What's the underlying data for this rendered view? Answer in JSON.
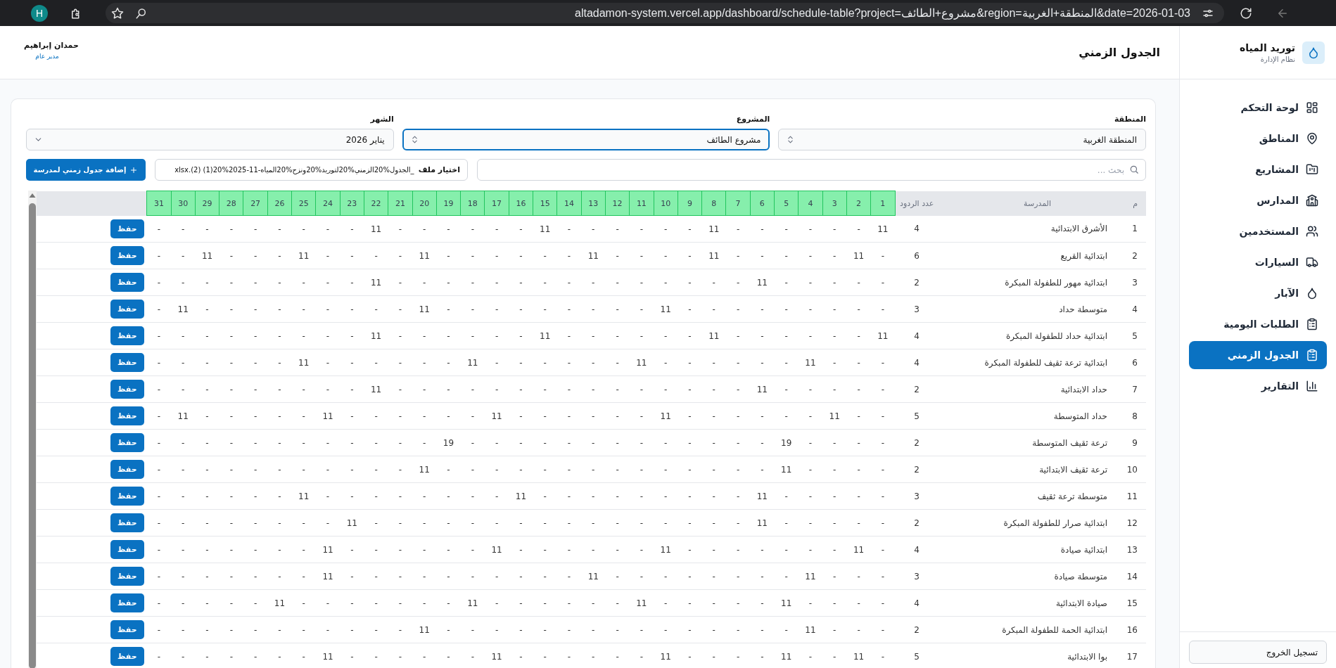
{
  "browser": {
    "profile_initial": "H",
    "url": "altadamon-system.vercel.app/dashboard/schedule-table?project=مشروع+الطائف&region=المنطقة+الغربية&date=2026-01-03"
  },
  "sidebar": {
    "brand": "توريد المياه",
    "subtitle": "نظام الإدارة",
    "items": [
      {
        "label": "لوحة التحكم",
        "selected": false
      },
      {
        "label": "المناطق",
        "selected": false
      },
      {
        "label": "المشاريع",
        "selected": false
      },
      {
        "label": "المدارس",
        "selected": false
      },
      {
        "label": "المستخدمين",
        "selected": false
      },
      {
        "label": "السيارات",
        "selected": false
      },
      {
        "label": "الآبار",
        "selected": false
      },
      {
        "label": "الطلبات اليومية",
        "selected": false
      },
      {
        "label": "الجدول الزمني",
        "selected": true
      },
      {
        "label": "التقارير",
        "selected": false
      }
    ],
    "logout": "تسجيل الخروج"
  },
  "header": {
    "title": "الجدول الزمني",
    "user_name": "حمدان إبراهيم",
    "user_role": "مدير عام"
  },
  "filters": [
    {
      "label": "المنطقة",
      "value": "المنطقة الغربية",
      "kind": "combobox",
      "focused": false
    },
    {
      "label": "المشروع",
      "value": "مشروع الطائف",
      "kind": "combobox",
      "focused": true
    },
    {
      "label": "الشهر",
      "value": "يناير 2026",
      "kind": "select",
      "focused": false
    }
  ],
  "toolbar": {
    "search": {
      "placeholder": "بحث ..."
    },
    "file": {
      "button": "اختيار ملف",
      "name": "_الجدول%20الزمني%20لتوريد%20ونزح%20المياه-11-2025%20(1) (2).xlsx"
    },
    "add_button": "إضافة جدول زمني لمدرسة"
  },
  "table": {
    "columns": {
      "index": "م",
      "school": "المدرسة",
      "count": "عدد الردود",
      "days": [
        "1",
        "2",
        "3",
        "4",
        "5",
        "6",
        "7",
        "8",
        "9",
        "10",
        "11",
        "12",
        "13",
        "14",
        "15",
        "16",
        "17",
        "18",
        "19",
        "20",
        "21",
        "22",
        "23",
        "24",
        "25",
        "26",
        "27",
        "28",
        "29",
        "30",
        "31"
      ]
    },
    "rows": [
      {
        "index": "1",
        "school": "الأشرق الابتدائية",
        "count": "4",
        "save": "حفظ",
        "cells": [
          "11",
          "-",
          "-",
          "-",
          "-",
          "-",
          "-",
          "11",
          "-",
          "-",
          "-",
          "-",
          "-",
          "-",
          "11",
          "-",
          "-",
          "-",
          "-",
          "-",
          "-",
          "11",
          "-",
          "-",
          "-",
          "-",
          "-",
          "-",
          "-",
          "-",
          "-"
        ]
      },
      {
        "index": "2",
        "school": "ابتدائية القريع",
        "count": "6",
        "save": "حفظ",
        "cells": [
          "-",
          "11",
          "-",
          "-",
          "-",
          "-",
          "-",
          "11",
          "-",
          "-",
          "-",
          "-",
          "11",
          "-",
          "-",
          "-",
          "-",
          "-",
          "-",
          "11",
          "-",
          "-",
          "-",
          "-",
          "11",
          "-",
          "-",
          "-",
          "11",
          "-",
          "-"
        ]
      },
      {
        "index": "3",
        "school": "ابتدائية مهور للطفولة المبكرة",
        "count": "2",
        "save": "حفظ",
        "cells": [
          "-",
          "-",
          "-",
          "-",
          "-",
          "11",
          "-",
          "-",
          "-",
          "-",
          "-",
          "-",
          "-",
          "-",
          "-",
          "-",
          "-",
          "-",
          "-",
          "-",
          "-",
          "11",
          "-",
          "-",
          "-",
          "-",
          "-",
          "-",
          "-",
          "-",
          "-"
        ]
      },
      {
        "index": "4",
        "school": "متوسطة حداد",
        "count": "3",
        "save": "حفظ",
        "cells": [
          "-",
          "-",
          "-",
          "-",
          "-",
          "-",
          "-",
          "-",
          "-",
          "11",
          "-",
          "-",
          "-",
          "-",
          "-",
          "-",
          "-",
          "-",
          "-",
          "11",
          "-",
          "-",
          "-",
          "-",
          "-",
          "-",
          "-",
          "-",
          "-",
          "11",
          "-"
        ]
      },
      {
        "index": "5",
        "school": "ابتدائية حداد للطفولة المبكرة",
        "count": "4",
        "save": "حفظ",
        "cells": [
          "11",
          "-",
          "-",
          "-",
          "-",
          "-",
          "-",
          "11",
          "-",
          "-",
          "-",
          "-",
          "-",
          "-",
          "11",
          "-",
          "-",
          "-",
          "-",
          "-",
          "-",
          "11",
          "-",
          "-",
          "-",
          "-",
          "-",
          "-",
          "-",
          "-",
          "-"
        ]
      },
      {
        "index": "6",
        "school": "ابتدائية ترعة ثقيف للطفولة المبكرة",
        "count": "4",
        "save": "حفظ",
        "cells": [
          "-",
          "-",
          "-",
          "11",
          "-",
          "-",
          "-",
          "-",
          "-",
          "-",
          "11",
          "-",
          "-",
          "-",
          "-",
          "-",
          "-",
          "11",
          "-",
          "-",
          "-",
          "-",
          "-",
          "-",
          "11",
          "-",
          "-",
          "-",
          "-",
          "-",
          "-"
        ]
      },
      {
        "index": "7",
        "school": "حداد الابتدائية",
        "count": "2",
        "save": "حفظ",
        "cells": [
          "-",
          "-",
          "-",
          "-",
          "-",
          "11",
          "-",
          "-",
          "-",
          "-",
          "-",
          "-",
          "-",
          "-",
          "-",
          "-",
          "-",
          "-",
          "-",
          "-",
          "-",
          "11",
          "-",
          "-",
          "-",
          "-",
          "-",
          "-",
          "-",
          "-",
          "-"
        ]
      },
      {
        "index": "8",
        "school": "حداد المتوسطة",
        "count": "5",
        "save": "حفظ",
        "cells": [
          "-",
          "-",
          "11",
          "-",
          "-",
          "-",
          "-",
          "-",
          "-",
          "11",
          "-",
          "-",
          "-",
          "-",
          "-",
          "-",
          "11",
          "-",
          "-",
          "-",
          "-",
          "-",
          "-",
          "11",
          "-",
          "-",
          "-",
          "-",
          "-",
          "11",
          "-"
        ]
      },
      {
        "index": "9",
        "school": "ترعة ثقيف المتوسطة",
        "count": "2",
        "save": "حفظ",
        "cells": [
          "-",
          "-",
          "-",
          "-",
          "19",
          "-",
          "-",
          "-",
          "-",
          "-",
          "-",
          "-",
          "-",
          "-",
          "-",
          "-",
          "-",
          "-",
          "19",
          "-",
          "-",
          "-",
          "-",
          "-",
          "-",
          "-",
          "-",
          "-",
          "-",
          "-",
          "-"
        ]
      },
      {
        "index": "10",
        "school": "ترعة ثقيف الابتدائية",
        "count": "2",
        "save": "حفظ",
        "cells": [
          "-",
          "-",
          "-",
          "-",
          "11",
          "-",
          "-",
          "-",
          "-",
          "-",
          "-",
          "-",
          "-",
          "-",
          "-",
          "-",
          "-",
          "-",
          "-",
          "11",
          "-",
          "-",
          "-",
          "-",
          "-",
          "-",
          "-",
          "-",
          "-",
          "-",
          "-"
        ]
      },
      {
        "index": "11",
        "school": "متوسطة ترعة ثقيف",
        "count": "3",
        "save": "حفظ",
        "cells": [
          "-",
          "-",
          "-",
          "-",
          "-",
          "11",
          "-",
          "-",
          "-",
          "-",
          "-",
          "-",
          "-",
          "-",
          "-",
          "11",
          "-",
          "-",
          "-",
          "-",
          "-",
          "-",
          "-",
          "-",
          "11",
          "-",
          "-",
          "-",
          "-",
          "-",
          "-"
        ]
      },
      {
        "index": "12",
        "school": "ابتدائية صرار للطفولة المبكرة",
        "count": "2",
        "save": "حفظ",
        "cells": [
          "-",
          "-",
          "-",
          "-",
          "-",
          "11",
          "-",
          "-",
          "-",
          "-",
          "-",
          "-",
          "-",
          "-",
          "-",
          "-",
          "-",
          "-",
          "-",
          "-",
          "-",
          "-",
          "11",
          "-",
          "-",
          "-",
          "-",
          "-",
          "-",
          "-",
          "-"
        ]
      },
      {
        "index": "13",
        "school": "ابتدائية صيادة",
        "count": "4",
        "save": "حفظ",
        "cells": [
          "-",
          "11",
          "-",
          "-",
          "-",
          "-",
          "-",
          "-",
          "-",
          "11",
          "-",
          "-",
          "-",
          "-",
          "-",
          "-",
          "11",
          "-",
          "-",
          "-",
          "-",
          "-",
          "-",
          "11",
          "-",
          "-",
          "-",
          "-",
          "-",
          "-",
          "-"
        ]
      },
      {
        "index": "14",
        "school": "متوسطة صيادة",
        "count": "3",
        "save": "حفظ",
        "cells": [
          "-",
          "-",
          "-",
          "11",
          "-",
          "-",
          "-",
          "-",
          "-",
          "-",
          "-",
          "-",
          "11",
          "-",
          "-",
          "-",
          "-",
          "-",
          "-",
          "-",
          "-",
          "-",
          "-",
          "11",
          "-",
          "-",
          "-",
          "-",
          "-",
          "-",
          "-"
        ]
      },
      {
        "index": "15",
        "school": "صيادة الابتدائية",
        "count": "4",
        "save": "حفظ",
        "cells": [
          "-",
          "-",
          "-",
          "-",
          "11",
          "-",
          "-",
          "-",
          "-",
          "-",
          "11",
          "-",
          "-",
          "-",
          "-",
          "-",
          "-",
          "11",
          "-",
          "-",
          "-",
          "-",
          "-",
          "-",
          "-",
          "11",
          "-",
          "-",
          "-",
          "-",
          "-"
        ]
      },
      {
        "index": "16",
        "school": "ابتدائية الحمة للطفولة المبكرة",
        "count": "2",
        "save": "حفظ",
        "cells": [
          "-",
          "-",
          "-",
          "11",
          "-",
          "-",
          "-",
          "-",
          "-",
          "-",
          "-",
          "-",
          "-",
          "-",
          "-",
          "-",
          "-",
          "-",
          "-",
          "11",
          "-",
          "-",
          "-",
          "-",
          "-",
          "-",
          "-",
          "-",
          "-",
          "-",
          "-"
        ]
      },
      {
        "index": "17",
        "school": "بوا الابتدائية",
        "count": "5",
        "save": "حفظ",
        "cells": [
          "-",
          "11",
          "-",
          "-",
          "11",
          "-",
          "-",
          "-",
          "-",
          "11",
          "-",
          "-",
          "-",
          "-",
          "-",
          "-",
          "11",
          "-",
          "-",
          "-",
          "-",
          "-",
          "-",
          "11",
          "-",
          "-",
          "-",
          "-",
          "-",
          "-",
          "-"
        ]
      }
    ]
  }
}
